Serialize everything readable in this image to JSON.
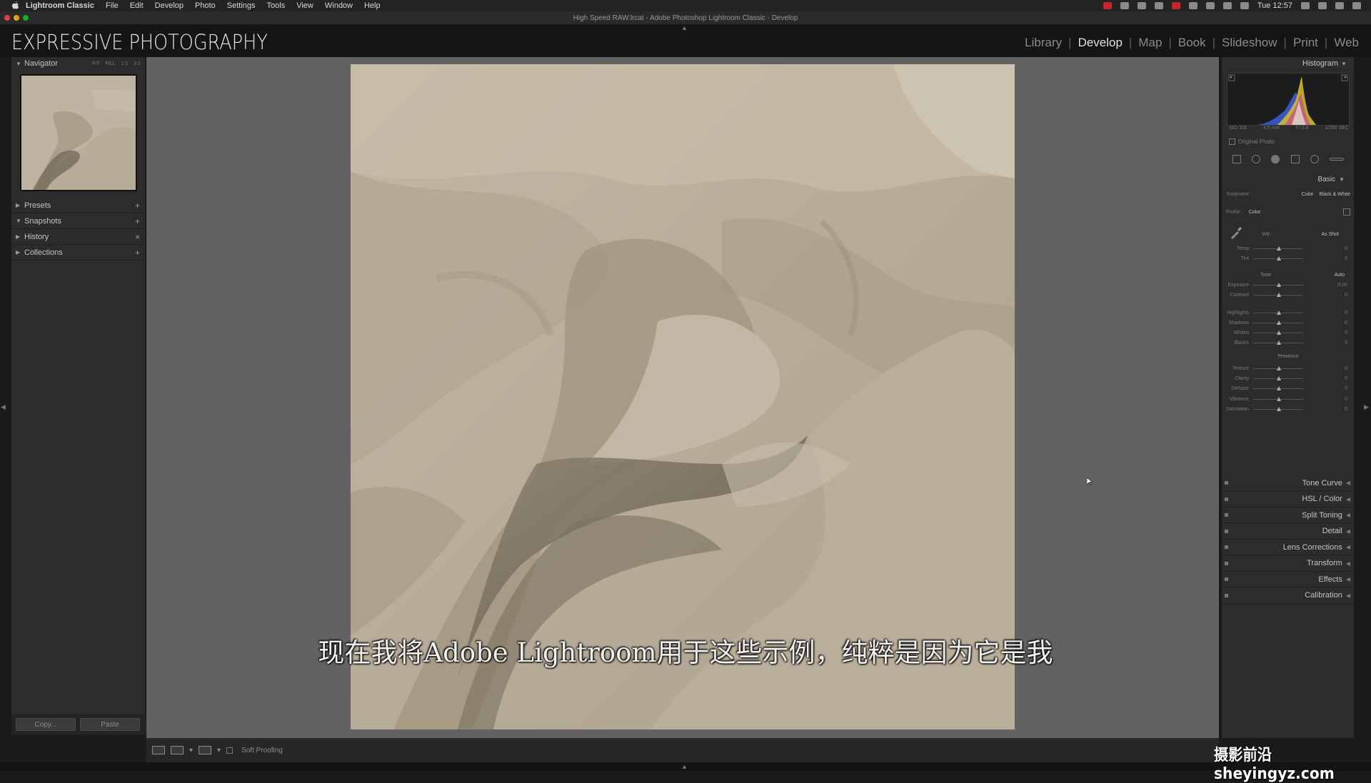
{
  "menubar": {
    "app": "Lightroom Classic",
    "menus": [
      "File",
      "Edit",
      "Develop",
      "Photo",
      "Settings",
      "Tools",
      "View",
      "Window",
      "Help"
    ],
    "clock": "Tue 12:57"
  },
  "window": {
    "title": "High Speed RAW.lrcat - Adobe Photoshop Lightroom Classic - Develop"
  },
  "identity_plate": "EXPRESSIVE PHOTOGRAPHY",
  "modules": [
    "Library",
    "Develop",
    "Map",
    "Book",
    "Slideshow",
    "Print",
    "Web"
  ],
  "active_module": "Develop",
  "left_panel": {
    "navigator": "Navigator",
    "zoom_options": [
      "FIT",
      "FILL",
      "1:1",
      "3:1"
    ],
    "sections": [
      {
        "label": "Presets",
        "control": "+"
      },
      {
        "label": "Snapshots",
        "control": "+"
      },
      {
        "label": "History",
        "control": "×"
      },
      {
        "label": "Collections",
        "control": "+"
      }
    ],
    "copy": "Copy...",
    "paste": "Paste"
  },
  "toolbar": {
    "soft_proofing": "Soft Proofing"
  },
  "right_panel": {
    "histogram": "Histogram",
    "exif": [
      "ISO 101",
      "4.5 mm",
      "f / 2.8",
      "1/250 SEC"
    ],
    "original_photo": "Original Photo",
    "basic": {
      "title": "Basic",
      "treatment_label": "Treatment :",
      "treatment_color": "Color",
      "treatment_bw": "Black & White",
      "profile_label": "Profile :",
      "profile_value": "Color",
      "wb_label": "WB :",
      "wb_value": "As Shot",
      "tone": "Tone",
      "auto": "Auto",
      "presence": "Presence",
      "sliders_wb": [
        {
          "label": "Temp",
          "value": "0"
        },
        {
          "label": "Tint",
          "value": "0"
        }
      ],
      "sliders_tone_a": [
        {
          "label": "Exposure",
          "value": "0.00"
        },
        {
          "label": "Contrast",
          "value": "0"
        }
      ],
      "sliders_tone_b": [
        {
          "label": "Highlights",
          "value": "0"
        },
        {
          "label": "Shadows",
          "value": "0"
        },
        {
          "label": "Whites",
          "value": "0"
        },
        {
          "label": "Blacks",
          "value": "0"
        }
      ],
      "sliders_presence_a": [
        {
          "label": "Texture",
          "value": "0"
        },
        {
          "label": "Clarity",
          "value": "0"
        },
        {
          "label": "Dehaze",
          "value": "0"
        }
      ],
      "sliders_presence_b": [
        {
          "label": "Vibrance",
          "value": "0"
        },
        {
          "label": "Saturation",
          "value": "0"
        }
      ]
    },
    "collapsed_panels": [
      "Tone Curve",
      "HSL / Color",
      "Split Toning",
      "Detail",
      "Lens Corrections",
      "Transform",
      "Effects",
      "Calibration"
    ]
  },
  "subtitle": "现在我将Adobe Lightroom用于这些示例，纯粹是因为它是我",
  "watermark": "摄影前沿 sheyingyz.com",
  "colors": {
    "accent_red": "#c7252b",
    "panel_bg": "#2c2c2c",
    "center_bg": "#626262",
    "sand": "#b8ad98"
  }
}
